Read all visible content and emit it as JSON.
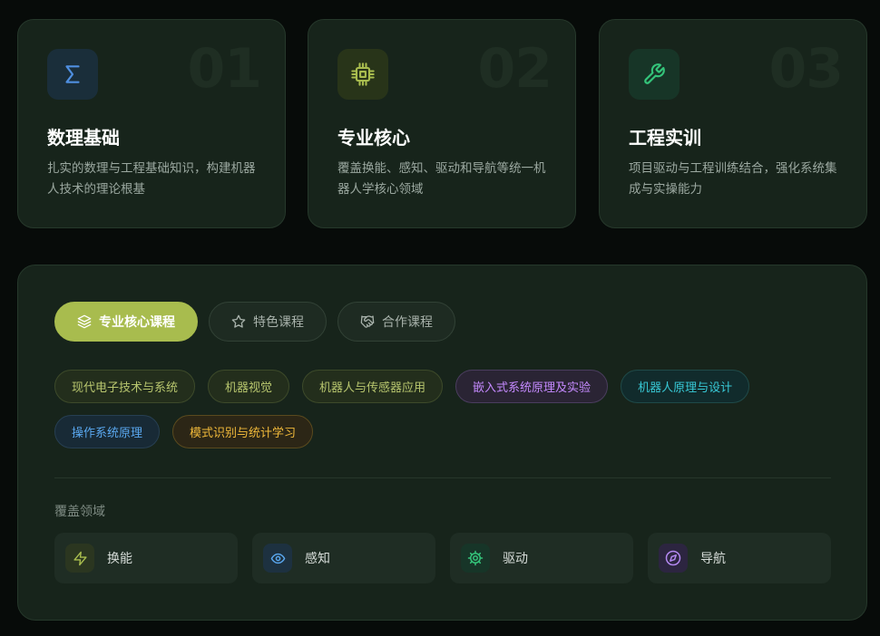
{
  "features": [
    {
      "num": "01",
      "title": "数理基础",
      "desc": "扎实的数理与工程基础知识，构建机器人技术的理论根基",
      "icon": "sigma-icon",
      "accent": "#4f8fe0"
    },
    {
      "num": "02",
      "title": "专业核心",
      "desc": "覆盖换能、感知、驱动和导航等统一机器人学核心领域",
      "icon": "chip-icon",
      "accent": "#a8bc4e"
    },
    {
      "num": "03",
      "title": "工程实训",
      "desc": "项目驱动与工程训练结合，强化系统集成与实操能力",
      "icon": "wrench-icon",
      "accent": "#34c47a"
    }
  ],
  "tabs": [
    {
      "label": "专业核心课程",
      "icon": "layers-icon",
      "active": true
    },
    {
      "label": "特色课程",
      "icon": "star-icon",
      "active": false
    },
    {
      "label": "合作课程",
      "icon": "handshake-icon",
      "active": false
    }
  ],
  "courses": [
    {
      "label": "现代电子技术与系统",
      "color": "olive"
    },
    {
      "label": "机器视觉",
      "color": "olive"
    },
    {
      "label": "机器人与传感器应用",
      "color": "olive"
    },
    {
      "label": "嵌入式系统原理及实验",
      "color": "purple"
    },
    {
      "label": "机器人原理与设计",
      "color": "teal"
    },
    {
      "label": "操作系统原理",
      "color": "blue"
    },
    {
      "label": "模式识别与统计学习",
      "color": "amber"
    }
  ],
  "coverage": {
    "title": "覆盖领域",
    "items": [
      {
        "label": "换能",
        "icon": "bolt-icon",
        "accent": "#a8bc4e"
      },
      {
        "label": "感知",
        "icon": "eye-icon",
        "accent": "#5aa8f0"
      },
      {
        "label": "驱动",
        "icon": "cog-icon",
        "accent": "#34c47a"
      },
      {
        "label": "导航",
        "icon": "compass-icon",
        "accent": "#b388f0"
      }
    ]
  }
}
